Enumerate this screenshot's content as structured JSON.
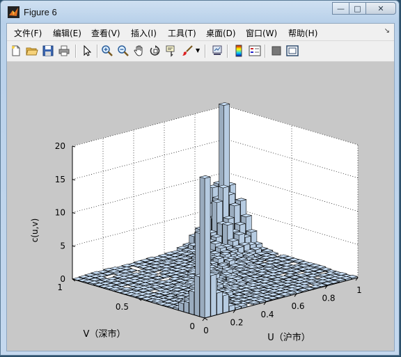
{
  "window": {
    "title": "Figure 6"
  },
  "menu": [
    "文件(F)",
    "编辑(E)",
    "查看(V)",
    "插入(I)",
    "工具(T)",
    "桌面(D)",
    "窗口(W)",
    "帮助(H)"
  ],
  "toolbar": [
    {
      "name": "new-figure-icon"
    },
    {
      "name": "open-file-icon"
    },
    {
      "name": "save-icon"
    },
    {
      "name": "print-icon"
    },
    {
      "name": "edit-plot-arrow-icon"
    },
    {
      "name": "zoom-in-icon"
    },
    {
      "name": "zoom-out-icon"
    },
    {
      "name": "pan-hand-icon"
    },
    {
      "name": "rotate-3d-icon"
    },
    {
      "name": "data-cursor-icon"
    },
    {
      "name": "brush-icon"
    },
    {
      "name": "link-plot-icon"
    },
    {
      "name": "colorbar-icon"
    },
    {
      "name": "legend-icon"
    },
    {
      "name": "hide-plot-tools-icon"
    },
    {
      "name": "show-plot-tools-icon"
    }
  ],
  "chart_data": {
    "type": "bar3",
    "title": "",
    "zlabel": "c(u,v)",
    "xlabel": "U（沪市）",
    "ylabel": "V（深市）",
    "zlim": [
      0,
      20
    ],
    "z_ticks": [
      "0",
      "5",
      "10",
      "15",
      "20"
    ],
    "x_ticks": [
      "0",
      "0.2",
      "0.4",
      "0.6",
      "0.8",
      "1"
    ],
    "y_ticks": [
      "0",
      "0.5",
      "1"
    ],
    "grid": true,
    "colors": {
      "bar_face": "#c6ddf5",
      "bar_edge": "#000000",
      "background": "#c8c8c8",
      "axes": "#ffffff"
    },
    "notable_bars": [
      {
        "u": 0.95,
        "v": 0.95,
        "value": 21
      },
      {
        "u": 0.02,
        "v": 0.02,
        "value": 21
      },
      {
        "u": 0.05,
        "v": 0.1,
        "value": 12
      }
    ]
  }
}
